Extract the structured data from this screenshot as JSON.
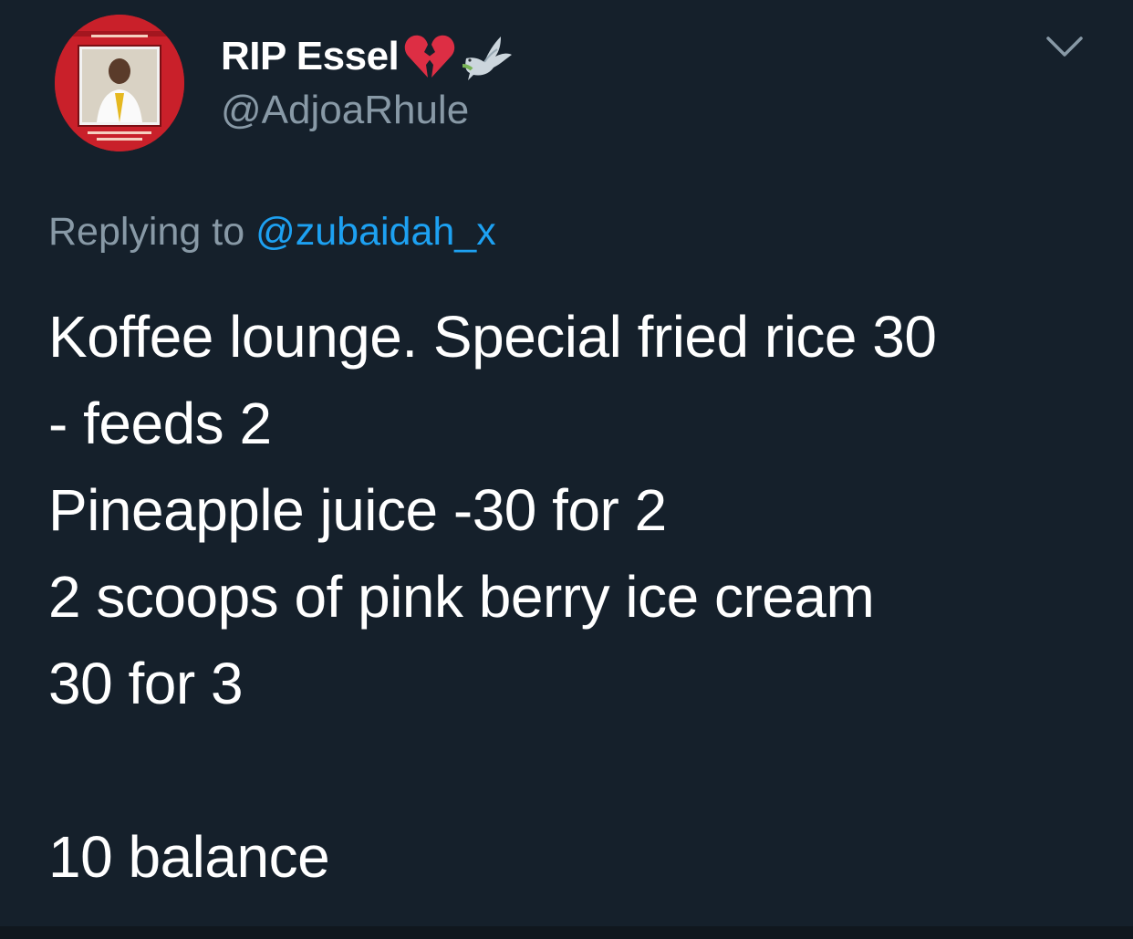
{
  "tweet": {
    "author": {
      "display_name": "RIP Essel",
      "name_emojis": [
        "broken-heart-icon",
        "dove-icon"
      ],
      "handle": "@AdjoaRhule",
      "avatar_icon": "memorial-portrait-avatar"
    },
    "reply": {
      "prefix": "Replying to",
      "mention": "@zubaidah_x"
    },
    "body_lines": [
      "Koffee lounge. Special fried rice 30",
      "- feeds 2",
      "Pineapple juice -30 for 2",
      "2 scoops of pink berry ice cream",
      "30 for 3",
      "",
      "10 balance"
    ],
    "menu_icon": "chevron-down-icon"
  },
  "colors": {
    "background": "#15202b",
    "text_primary": "#ffffff",
    "text_secondary": "#8899a6",
    "link": "#1da1f2",
    "avatar_frame": "#c9202a"
  }
}
